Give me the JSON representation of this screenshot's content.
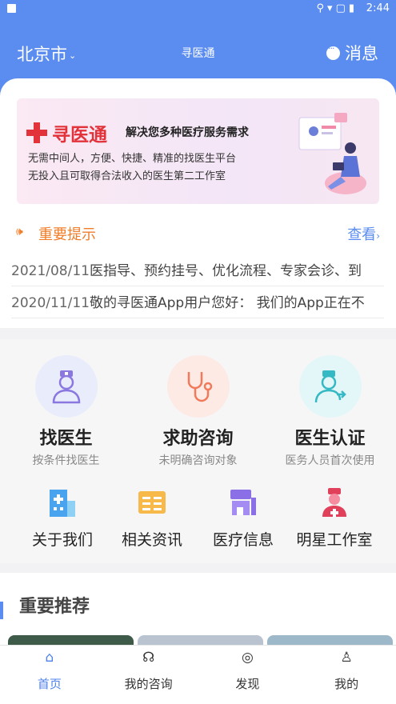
{
  "status_bar": {
    "time": "2:44",
    "icons": [
      "location-icon",
      "wifi-icon",
      "signal-icon",
      "battery-icon"
    ]
  },
  "header": {
    "city": "北京市",
    "title": "寻医通",
    "messages_label": "消息"
  },
  "banner": {
    "logo_text": "寻医通",
    "slogan": "解决您多种医疗服务需求",
    "line1": "无需中间人，方便、快捷、精准的找医生平台",
    "line2": "无投入且可取得合法收入的医生第二工作室"
  },
  "notice": {
    "title": "重要提示",
    "more": "查看",
    "items": [
      {
        "date": "2021/08/11",
        "text": "医指导、预约挂号、优化流程、专家会诊、到"
      },
      {
        "date": "2020/11/11",
        "text": "敬的寻医通App用户您好：  我们的App正在不"
      }
    ]
  },
  "main_services": [
    {
      "title": "找医生",
      "subtitle": "按条件找医生",
      "icon": "doctor-icon"
    },
    {
      "title": "求助咨询",
      "subtitle": "未明确咨询对象",
      "icon": "stethoscope-icon"
    },
    {
      "title": "医生认证",
      "subtitle": "医务人员首次使用",
      "icon": "doctor-certify-icon"
    }
  ],
  "secondary_services": [
    {
      "label": "关于我们",
      "icon": "hospital-building-icon"
    },
    {
      "label": "相关资讯",
      "icon": "news-icon"
    },
    {
      "label": "医疗信息",
      "icon": "medical-info-icon"
    },
    {
      "label": "明星工作室",
      "icon": "nurse-icon"
    }
  ],
  "recommend": {
    "title": "重要推荐"
  },
  "tabbar": [
    {
      "label": "首页",
      "icon": "home-icon",
      "active": true
    },
    {
      "label": "我的咨询",
      "icon": "headset-icon",
      "active": false
    },
    {
      "label": "发现",
      "icon": "compass-icon",
      "active": false
    },
    {
      "label": "我的",
      "icon": "user-icon",
      "active": false
    }
  ],
  "colors": {
    "primary": "#5b8cf0",
    "notice": "#f07d2a",
    "brand_red": "#e2333b"
  }
}
